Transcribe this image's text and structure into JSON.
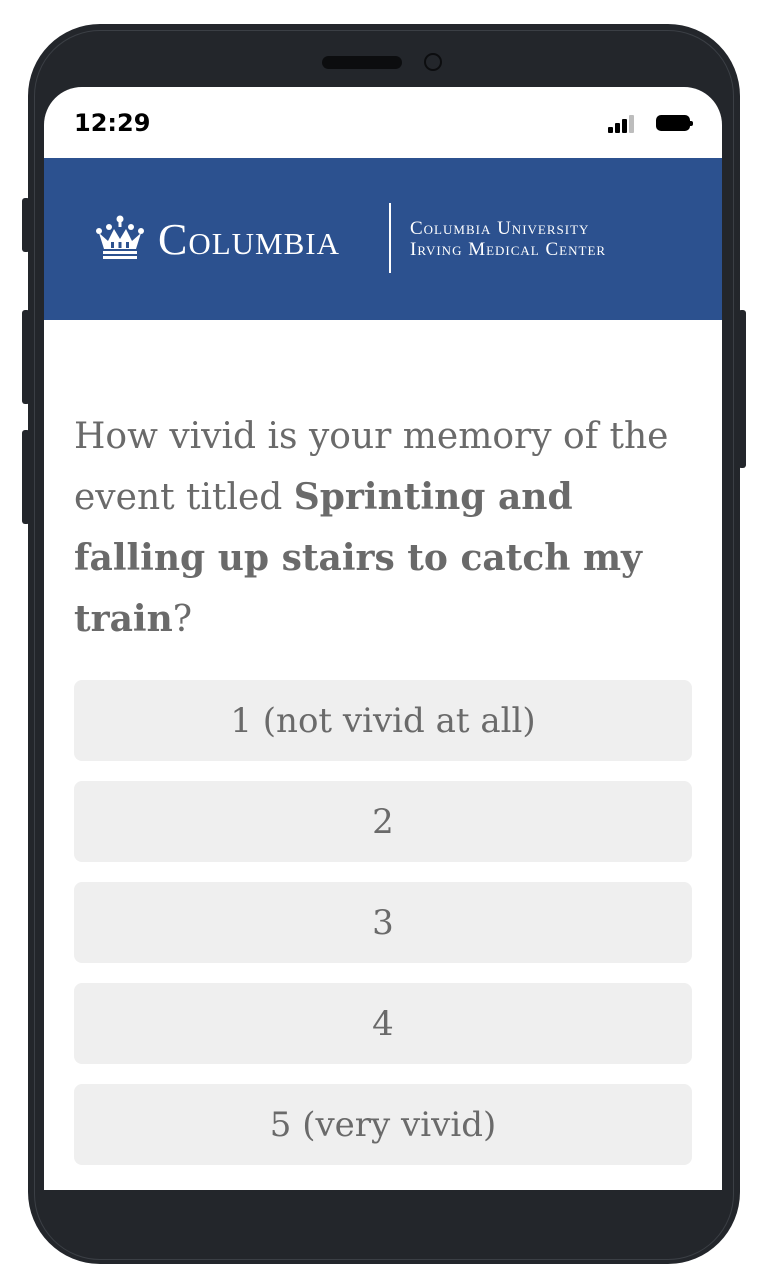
{
  "status_bar": {
    "time": "12:29"
  },
  "header": {
    "logo_wordmark": "Columbia",
    "logo_subtitle_line1": "Columbia University",
    "logo_subtitle_line2": "Irving Medical Center",
    "background_color": "#2c518f"
  },
  "question": {
    "prefix": "How vivid is your memory of the event titled ",
    "event_title": "Sprinting and falling up stairs to catch my train",
    "suffix": "?"
  },
  "answers": [
    {
      "label": "1 (not vivid at all)"
    },
    {
      "label": "2"
    },
    {
      "label": "3"
    },
    {
      "label": "4"
    },
    {
      "label": "5 (very vivid)"
    }
  ]
}
